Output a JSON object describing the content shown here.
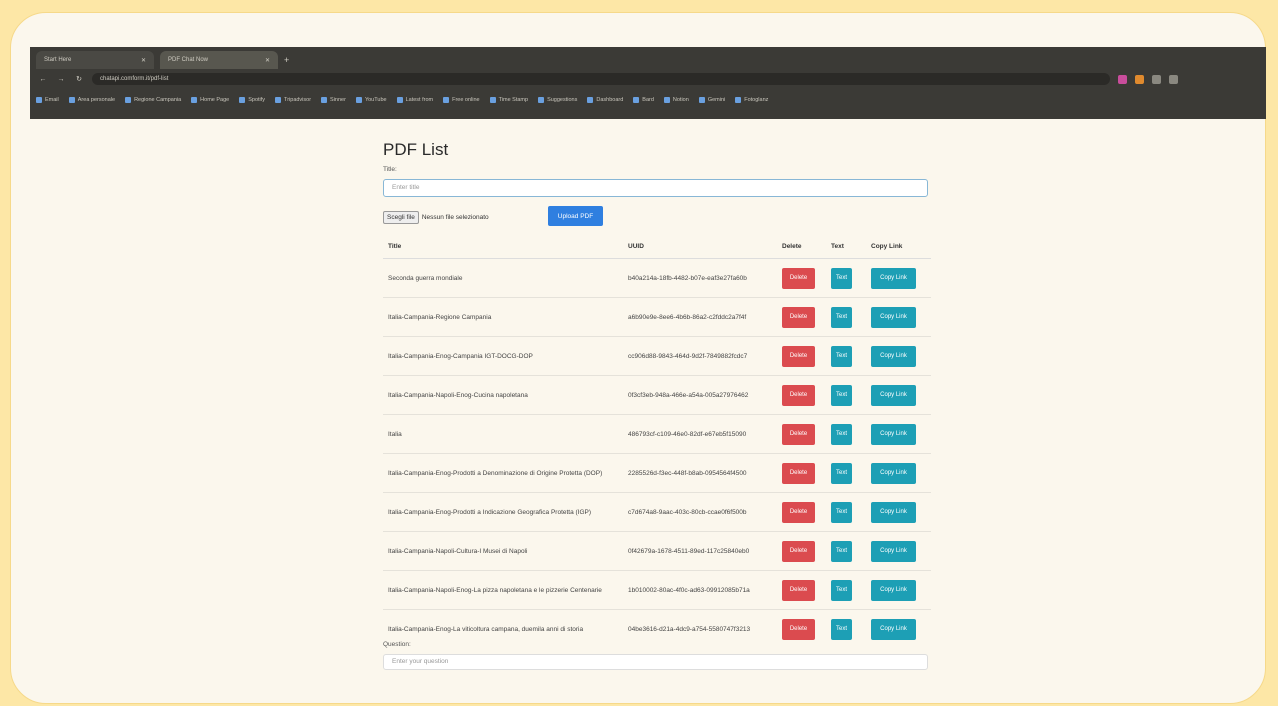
{
  "browser": {
    "tabs": [
      {
        "label": "Start Here"
      },
      {
        "label": "PDF Chat Now"
      }
    ],
    "address": "chatapi.comform.it/pdf-list",
    "bookmarks": [
      "Email",
      "Area personale",
      "Regione Campania",
      "Home Page",
      "Spotify",
      "Tripadvisor",
      "Sinner",
      "YouTube",
      "Latest from",
      "Free online",
      "Time Stamp",
      "Suggestions",
      "Dashboard",
      "Bard",
      "Notion",
      "Gemini",
      "Fotoglanz"
    ]
  },
  "page": {
    "title": "PDF List",
    "title_label": "Title:",
    "title_placeholder": "Enter title",
    "file_button": "Scegli file",
    "file_status": "Nessun file selezionato",
    "upload_button": "Upload PDF",
    "columns": {
      "title": "Title",
      "uuid": "UUID",
      "delete": "Delete",
      "text": "Text",
      "copy": "Copy Link"
    },
    "rows": [
      {
        "title": "Seconda guerra mondiale",
        "uuid": "b40a214a-18fb-4482-b07e-eaf3e27fa60b",
        "delete": "Delete",
        "text": "Text",
        "copy": "Copy Link"
      },
      {
        "title": "Italia-Campania-Regione Campania",
        "uuid": "a6b90e9e-8ee6-4b6b-86a2-c2fddc2a7f4f",
        "delete": "Delete",
        "text": "Text",
        "copy": "Copy Link"
      },
      {
        "title": "Italia-Campania-Enog-Campania IGT-DOCG-DOP",
        "uuid": "cc906d88-9843-464d-9d2f-7849882fcdc7",
        "delete": "Delete",
        "text": "Text",
        "copy": "Copy Link"
      },
      {
        "title": "Italia-Campania-Napoli-Enog-Cucina napoletana",
        "uuid": "0f3cf3eb-948a-466e-a54a-005a27976462",
        "delete": "Delete",
        "text": "Text",
        "copy": "Copy Link"
      },
      {
        "title": "Italia",
        "uuid": "486793cf-c109-46e0-82df-e67eb5f15090",
        "delete": "Delete",
        "text": "Text",
        "copy": "Copy Link"
      },
      {
        "title": "Italia-Campania-Enog-Prodotti a Denominazione di Origine Protetta (DOP)",
        "uuid": "2285526d-f3ec-448f-b8ab-0954564f4500",
        "delete": "Delete",
        "text": "Text",
        "copy": "Copy Link"
      },
      {
        "title": "Italia-Campania-Enog-Prodotti a Indicazione Geografica Protetta (IGP)",
        "uuid": "c7d674a8-9aac-403c-80cb-ccae0f6f500b",
        "delete": "Delete",
        "text": "Text",
        "copy": "Copy Link"
      },
      {
        "title": "Italia-Campania-Napoli-Cultura-I Musei di Napoli",
        "uuid": "0f42679a-1678-4511-89ed-117c25840eb0",
        "delete": "Delete",
        "text": "Text",
        "copy": "Copy Link"
      },
      {
        "title": "Italia-Campania-Napoli-Enog-La pizza napoletana e le pizzerie Centenarie",
        "uuid": "1b010002-80ac-4f0c-ad63-09912085b71a",
        "delete": "Delete",
        "text": "Text",
        "copy": "Copy Link"
      },
      {
        "title": "Italia-Campania-Enog-La viticoltura campana, duemila anni di storia",
        "uuid": "04be3616-d21a-4dc9-a754-5580747f3213",
        "delete": "Delete",
        "text": "Text",
        "copy": "Copy Link"
      }
    ],
    "question_label": "Question:",
    "question_placeholder": "Enter your question"
  }
}
